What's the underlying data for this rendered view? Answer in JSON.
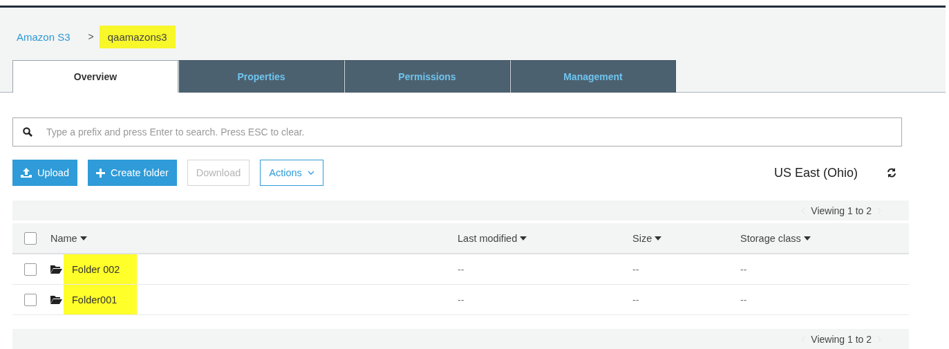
{
  "breadcrumb": [
    {
      "label": "Amazon S3",
      "kind": "link",
      "highlighted": false
    },
    {
      "label": "qaamazons3",
      "kind": "current",
      "highlighted": true
    }
  ],
  "breadcrumb_separator": ">",
  "tabs": [
    {
      "label": "Overview",
      "selected": true
    },
    {
      "label": "Properties",
      "selected": false
    },
    {
      "label": "Permissions",
      "selected": false
    },
    {
      "label": "Management",
      "selected": false
    }
  ],
  "search": {
    "placeholder": "Type a prefix and press Enter to search. Press ESC to clear."
  },
  "actions": [
    {
      "label": "Upload",
      "kind": "upload",
      "disabled": false
    },
    {
      "label": "Create folder",
      "kind": "create",
      "disabled": false
    },
    {
      "label": "Download",
      "kind": "plain",
      "disabled": true
    },
    {
      "label": "Actions",
      "kind": "menu",
      "disabled": false
    }
  ],
  "region": "US East (Ohio)",
  "pager_top": "Viewing 1 to 2",
  "table": {
    "select_all_checked": false,
    "columns": [
      "Name",
      "Last modified",
      "Size",
      "Storage class"
    ],
    "rows": [
      {
        "checked": false,
        "name": "Folder 002",
        "highlighted": true,
        "last_modified": "--",
        "size": "--",
        "storage_class": "--"
      },
      {
        "checked": false,
        "name": "Folder001",
        "highlighted": true,
        "last_modified": "--",
        "size": "--",
        "storage_class": "--"
      }
    ]
  },
  "pager_bottom": "Viewing 1 to 2"
}
